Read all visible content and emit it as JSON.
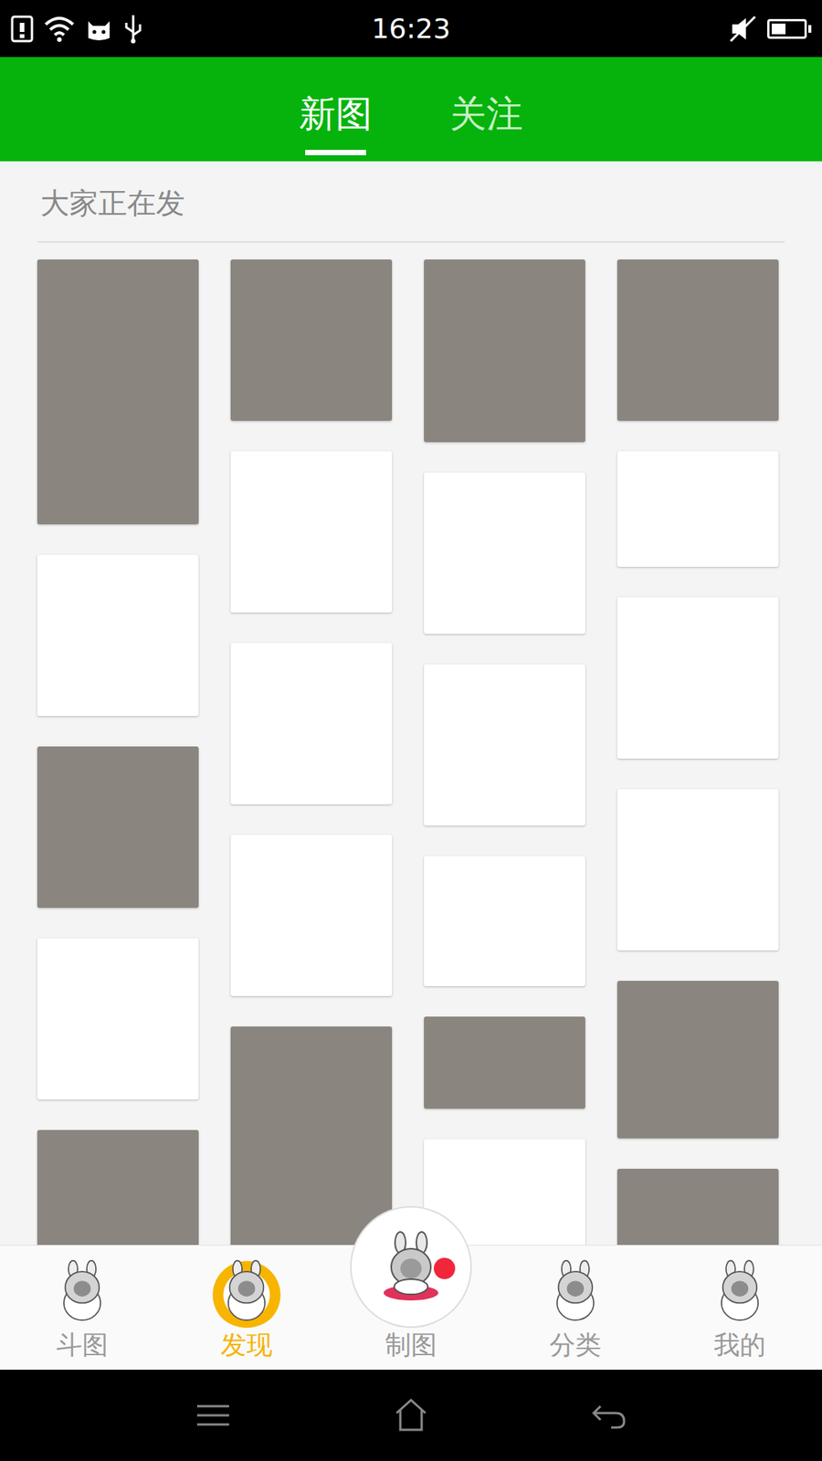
{
  "status_bar": {
    "time": "16:23",
    "muted": true,
    "battery": {
      "level": 0.45
    }
  },
  "header": {
    "tabs": [
      {
        "label": "新图",
        "selected": true
      },
      {
        "label": "关注",
        "selected": false
      }
    ]
  },
  "section": {
    "title": "大家正在发"
  },
  "feed": {
    "columns": [
      [
        {
          "kind": "photo"
        },
        {
          "kind": "drawing"
        },
        {
          "kind": "photo"
        },
        {
          "kind": "drawing"
        },
        {
          "kind": "photo"
        }
      ],
      [
        {
          "kind": "photo"
        },
        {
          "kind": "drawing"
        },
        {
          "kind": "drawing"
        },
        {
          "kind": "drawing"
        },
        {
          "kind": "photo"
        }
      ],
      [
        {
          "kind": "photo"
        },
        {
          "kind": "drawing"
        },
        {
          "kind": "drawing"
        },
        {
          "kind": "drawing"
        },
        {
          "kind": "photo"
        },
        {
          "kind": "drawing"
        }
      ],
      [
        {
          "kind": "photo"
        },
        {
          "kind": "drawing"
        },
        {
          "kind": "drawing"
        },
        {
          "kind": "drawing"
        },
        {
          "kind": "photo"
        },
        {
          "kind": "photo"
        }
      ]
    ]
  },
  "bottom_nav": [
    {
      "label": "斗图",
      "selected": false,
      "kind": "tab",
      "badge": false
    },
    {
      "label": "发现",
      "selected": true,
      "kind": "tab",
      "badge": false
    },
    {
      "label": "制图",
      "selected": false,
      "kind": "center",
      "badge": true
    },
    {
      "label": "分类",
      "selected": false,
      "kind": "tab",
      "badge": false
    },
    {
      "label": "我的",
      "selected": false,
      "kind": "tab",
      "badge": false
    }
  ]
}
